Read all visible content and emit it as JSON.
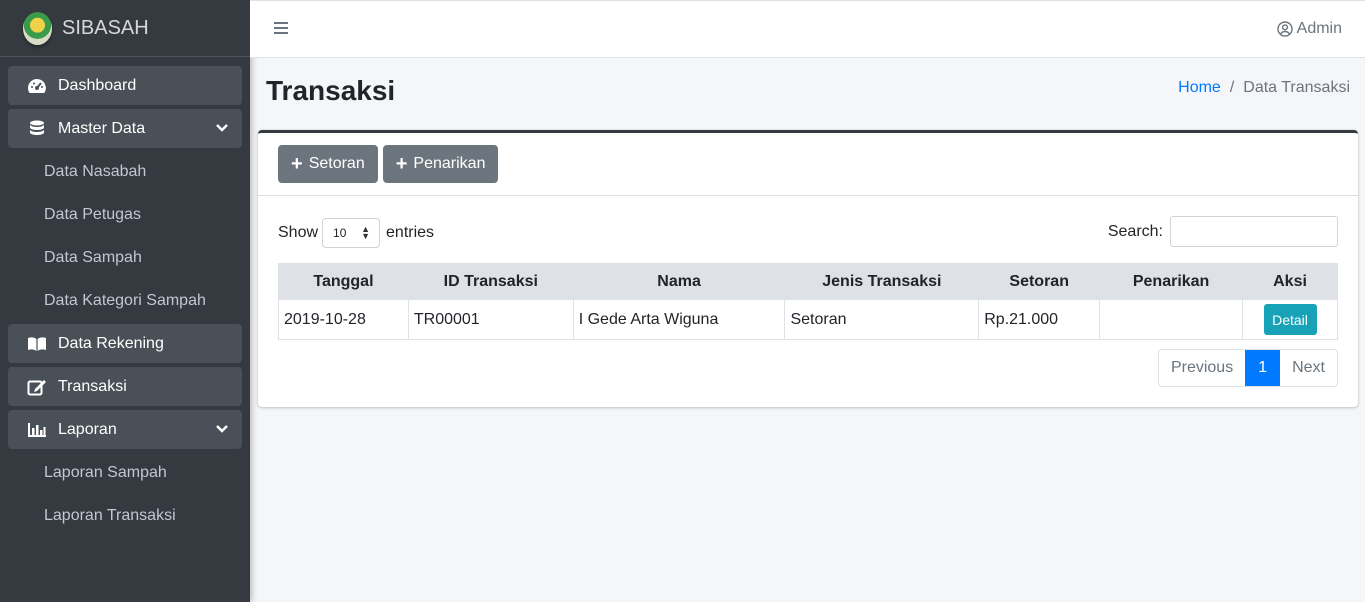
{
  "brand": {
    "name": "SIBASAH"
  },
  "sidebar": {
    "items": [
      {
        "label": "Dashboard",
        "icon": "tachometer-icon"
      },
      {
        "label": "Master Data",
        "icon": "database-icon"
      },
      {
        "label": "Data Nasabah"
      },
      {
        "label": "Data Petugas"
      },
      {
        "label": "Data Sampah"
      },
      {
        "label": "Data Kategori Sampah"
      },
      {
        "label": "Data Rekening",
        "icon": "book-icon"
      },
      {
        "label": "Transaksi",
        "icon": "edit-icon"
      },
      {
        "label": "Laporan",
        "icon": "chart-bar-icon"
      },
      {
        "label": "Laporan Sampah"
      },
      {
        "label": "Laporan Transaksi"
      }
    ]
  },
  "topnav": {
    "user": "Admin"
  },
  "header": {
    "title": "Transaksi",
    "breadcrumb_home": "Home",
    "breadcrumb_sep": "/",
    "breadcrumb_current": "Data Transaksi"
  },
  "card": {
    "btn_setoran": "Setoran",
    "btn_penarikan": "Penarikan",
    "show_label": "Show",
    "entries_value": "10",
    "entries_label": "entries",
    "search_label": "Search:",
    "search_value": ""
  },
  "table": {
    "columns": [
      "Tanggal",
      "ID Transaksi",
      "Nama",
      "Jenis Transaksi",
      "Setoran",
      "Penarikan",
      "Aksi"
    ],
    "rows": [
      {
        "tanggal": "2019-10-28",
        "id": "TR00001",
        "nama": "I Gede Arta Wiguna",
        "jenis": "Setoran",
        "setoran": "Rp.21.000",
        "penarikan": "",
        "aksi": "Detail"
      }
    ]
  },
  "pagination": {
    "previous": "Previous",
    "page": "1",
    "next": "Next"
  },
  "colors": {
    "sidebar": "#343a40",
    "primary": "#007bff",
    "info": "#17a2b8",
    "secondary": "#6c757d"
  }
}
